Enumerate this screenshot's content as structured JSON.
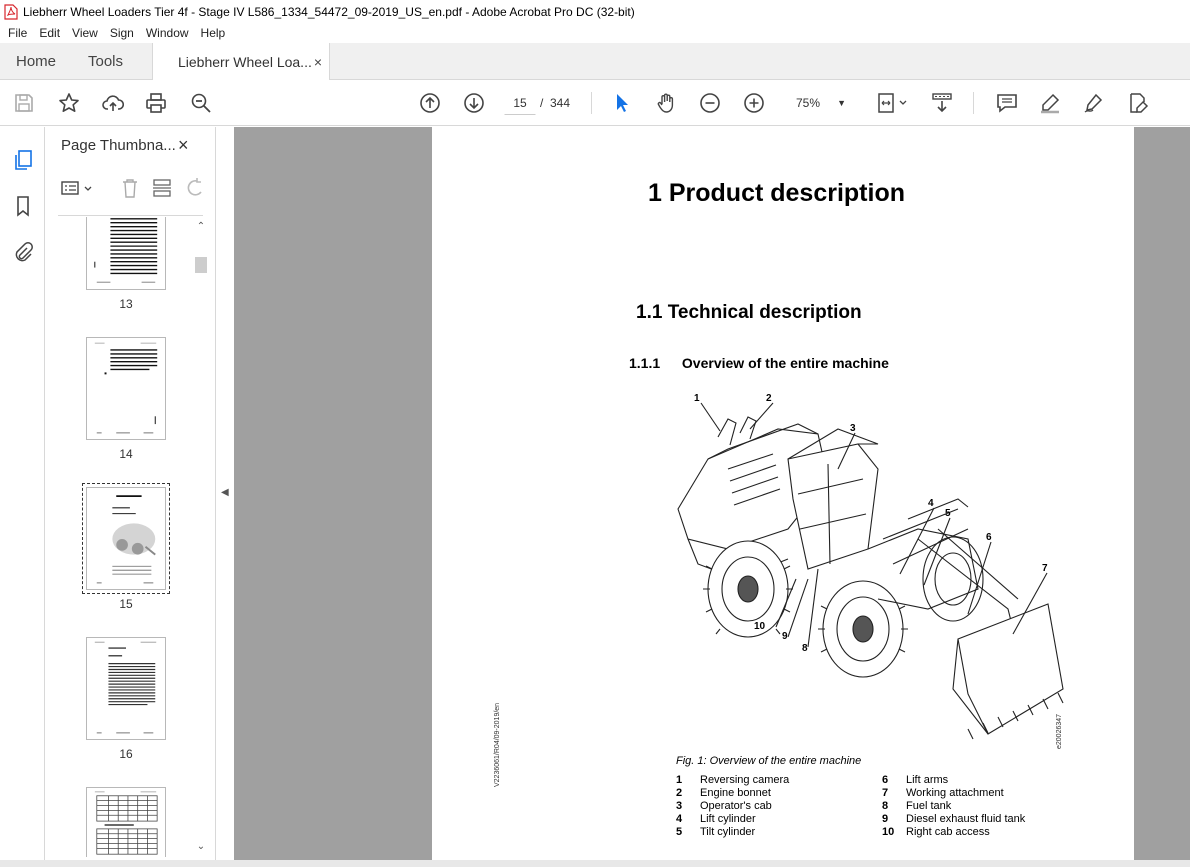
{
  "window": {
    "title": "Liebherr Wheel Loaders Tier 4f - Stage IV L586_1334_54472_09-2019_US_en.pdf - Adobe Acrobat Pro DC (32-bit)"
  },
  "menu": {
    "items": [
      "File",
      "Edit",
      "View",
      "Sign",
      "Window",
      "Help"
    ]
  },
  "tabs": {
    "home": "Home",
    "tools": "Tools",
    "document": "Liebherr Wheel Loa...",
    "close": "×"
  },
  "toolbar": {
    "current_page": "15",
    "separator": "/",
    "total_pages": "344",
    "zoom": "75%"
  },
  "panel": {
    "title": "Page Thumbna...",
    "close": "×",
    "thumbnails": [
      {
        "number": "13"
      },
      {
        "number": "14"
      },
      {
        "number": "15",
        "selected": true
      },
      {
        "number": "16"
      }
    ]
  },
  "document": {
    "h1": "1  Product description",
    "h2": "1.1  Technical description",
    "h3_num": "1.1.1",
    "h3_text": "Overview of the entire machine",
    "figure_caption": "Fig. 1: Overview of the entire machine",
    "figure_code": "e20026347",
    "side_code": "V2236061/R04/09-2019/en",
    "callouts": [
      "1",
      "2",
      "3",
      "4",
      "5",
      "6",
      "7",
      "8",
      "9",
      "10"
    ],
    "legend_left": [
      {
        "n": "1",
        "label": "Reversing camera"
      },
      {
        "n": "2",
        "label": "Engine bonnet"
      },
      {
        "n": "3",
        "label": "Operator's cab"
      },
      {
        "n": "4",
        "label": "Lift cylinder"
      },
      {
        "n": "5",
        "label": "Tilt cylinder"
      }
    ],
    "legend_right": [
      {
        "n": "6",
        "label": "Lift arms"
      },
      {
        "n": "7",
        "label": "Working attachment"
      },
      {
        "n": "8",
        "label": "Fuel tank"
      },
      {
        "n": "9",
        "label": "Diesel exhaust fluid tank"
      },
      {
        "n": "10",
        "label": "Right cab access"
      }
    ]
  },
  "colors": {
    "accent": "#1473e6",
    "pdf_red": "#d7262c",
    "doc_bg": "#a0a0a0"
  }
}
